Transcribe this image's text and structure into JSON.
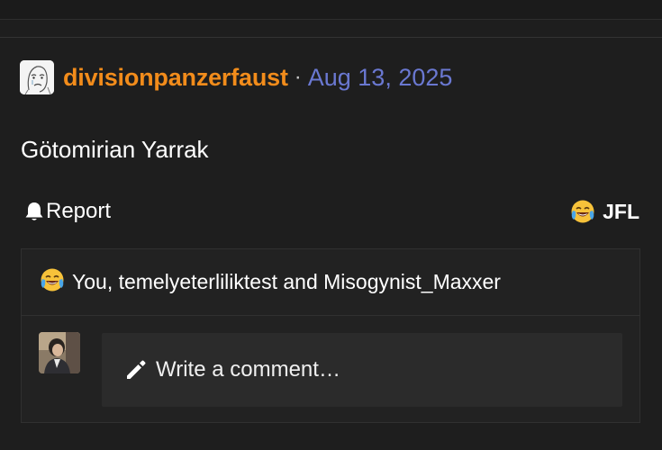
{
  "post": {
    "author": "divisionpanzerfaust",
    "separator": "·",
    "date": "Aug 13, 2025",
    "body": "Götomirian Yarrak"
  },
  "actions": {
    "report_label": "Report",
    "reaction_label": "JFL"
  },
  "reactions": {
    "summary": "You, temelyeterliliktest and Misogynist_Maxxer"
  },
  "comment": {
    "placeholder": "Write a comment…"
  },
  "icons": {
    "report": "bell-icon",
    "reaction": "crying-laughing-emoji-icon",
    "comment": "pencil-icon"
  },
  "colors": {
    "background": "#1e1e1e",
    "author": "#f28c1b",
    "date": "#6a78d1",
    "panel": "#222222",
    "input": "#2b2b2b"
  }
}
